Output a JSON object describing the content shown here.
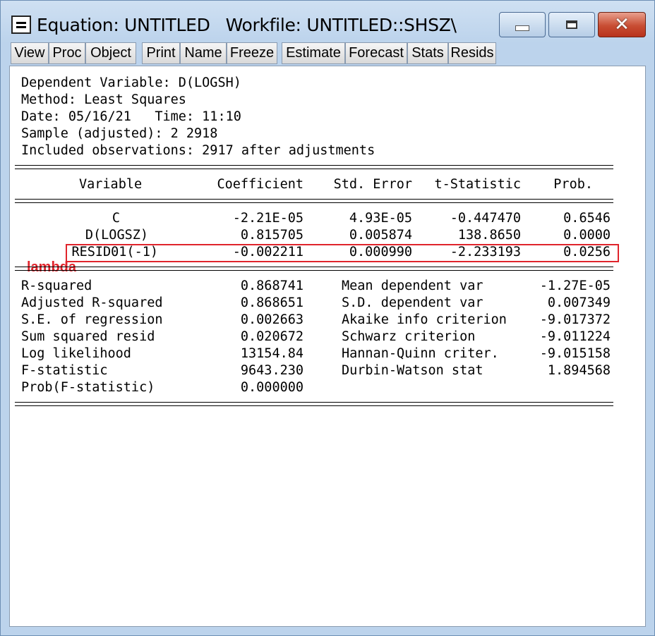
{
  "window": {
    "title": "Equation: UNTITLED",
    "workfile": "Workfile: UNTITLED::SHSZ\\"
  },
  "toolbar": [
    "View",
    "Proc",
    "Object",
    "Print",
    "Name",
    "Freeze",
    "Estimate",
    "Forecast",
    "Stats",
    "Resids"
  ],
  "header": {
    "dependent": "Dependent Variable: D(LOGSH)",
    "method": "Method: Least Squares",
    "date": "Date: 05/16/21   Time: 11:10",
    "sample": "Sample (adjusted): 2 2918",
    "obs": "Included observations: 2917 after adjustments"
  },
  "columns": [
    "Variable",
    "Coefficient",
    "Std. Error",
    "t-Statistic",
    "Prob."
  ],
  "rows": [
    {
      "variable": "C",
      "coef": "-2.21E-05",
      "se": "4.93E-05",
      "t": "-0.447470",
      "p": "0.6546"
    },
    {
      "variable": "D(LOGSZ)",
      "coef": "0.815705",
      "se": "0.005874",
      "t": "138.8650",
      "p": "0.0000"
    },
    {
      "variable": "RESID01(-1)",
      "coef": "-0.002211",
      "se": "0.000990",
      "t": "-2.233193",
      "p": "0.0256"
    }
  ],
  "annotation": "lambda",
  "stats_left": [
    {
      "label": "R-squared",
      "value": "0.868741"
    },
    {
      "label": "Adjusted R-squared",
      "value": "0.868651"
    },
    {
      "label": "S.E. of regression",
      "value": "0.002663"
    },
    {
      "label": "Sum squared resid",
      "value": "0.020672"
    },
    {
      "label": "Log likelihood",
      "value": "13154.84"
    },
    {
      "label": "F-statistic",
      "value": "9643.230"
    },
    {
      "label": "Prob(F-statistic)",
      "value": "0.000000"
    }
  ],
  "stats_right": [
    {
      "label": "Mean dependent var",
      "value": "-1.27E-05"
    },
    {
      "label": "S.D. dependent var",
      "value": "0.007349"
    },
    {
      "label": "Akaike info criterion",
      "value": "-9.017372"
    },
    {
      "label": "Schwarz criterion",
      "value": "-9.011224"
    },
    {
      "label": "Hannan-Quinn criter.",
      "value": "-9.015158"
    },
    {
      "label": "Durbin-Watson stat",
      "value": "1.894568"
    }
  ]
}
